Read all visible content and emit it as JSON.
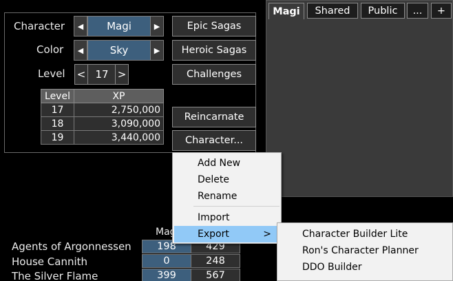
{
  "character_panel": {
    "character_label": "Character",
    "character_value": "Magi",
    "color_label": "Color",
    "color_value": "Sky",
    "level_label": "Level",
    "level_value": "17",
    "level_dec": "<",
    "level_inc": ">",
    "prev_arrow": "◀",
    "next_arrow": "▶"
  },
  "xp_table": {
    "headers": [
      "Level",
      "XP"
    ],
    "rows": [
      {
        "level": "17",
        "xp": "2,750,000"
      },
      {
        "level": "18",
        "xp": "3,090,000"
      },
      {
        "level": "19",
        "xp": "3,440,000"
      }
    ]
  },
  "buttons": {
    "epic_sagas": "Epic Sagas",
    "heroic_sagas": "Heroic Sagas",
    "challenges": "Challenges",
    "reincarnate": "Reincarnate",
    "character": "Character..."
  },
  "tabs": [
    {
      "label": "Magi",
      "active": true
    },
    {
      "label": "Shared",
      "active": false
    },
    {
      "label": "Public",
      "active": false
    },
    {
      "label": "...",
      "active": false
    },
    {
      "label": "+",
      "active": false
    }
  ],
  "favor": {
    "header": "Magi",
    "rows": [
      {
        "name": "Agents of Argonnessen",
        "v1": "198",
        "v2": "429"
      },
      {
        "name": "House Cannith",
        "v1": "0",
        "v2": "248"
      },
      {
        "name": "The Silver Flame",
        "v1": "399",
        "v2": "567"
      }
    ]
  },
  "context_menu": {
    "items": [
      "Add New",
      "Delete",
      "Rename",
      "Import",
      "Export"
    ],
    "submenu_arrow": ">"
  },
  "export_submenu": {
    "items": [
      "Character Builder Lite",
      "Ron's Character Planner",
      "DDO Builder"
    ]
  },
  "colors": {
    "accent_blue": "#3d5f7d",
    "menu_highlight": "#91c9f7",
    "background": "#000000"
  }
}
